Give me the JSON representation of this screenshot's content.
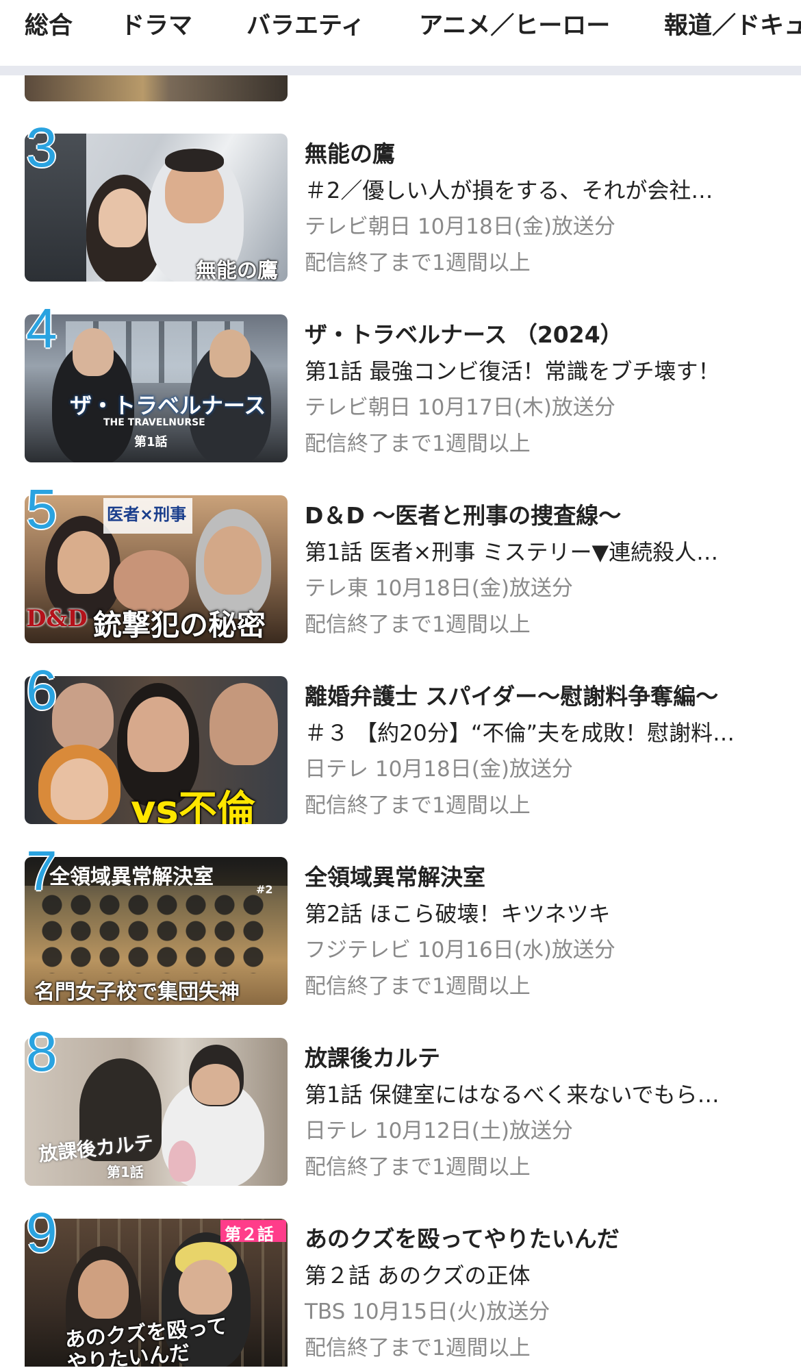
{
  "tabs": [
    {
      "label": "総合"
    },
    {
      "label": "ドラマ"
    },
    {
      "label": "バラエティ"
    },
    {
      "label": "アニメ／ヒーロー"
    },
    {
      "label": "報道／ドキュ"
    }
  ],
  "active_tab": "ドラマ",
  "accent_color": "#2aa3e0",
  "items": [
    {
      "rank": "3",
      "title": "無能の鷹",
      "episode": "＃2／優しい人が損をする、それが会社…",
      "meta": "テレビ朝日 10月18日(金)放送分",
      "remaining": "配信終了まで1週間以上",
      "thumb_text": "無能の鷹"
    },
    {
      "rank": "4",
      "title": "ザ・トラベルナース （2024）",
      "episode": "第1話 最強コンビ復活！常識をブチ壊す！",
      "meta": "テレビ朝日 10月17日(木)放送分",
      "remaining": "配信終了まで1週間以上",
      "thumb_text": "ザ・トラベルナース",
      "thumb_sub": "THE TRAVELNURSE",
      "thumb_ep": "第1話"
    },
    {
      "rank": "5",
      "title": "D＆D ～医者と刑事の捜査線～",
      "episode": "第1話 医者×刑事 ミステリー▼連続殺人…",
      "meta": "テレ東 10月18日(金)放送分",
      "remaining": "配信終了まで1週間以上",
      "thumb_text": "銃撃犯の秘密",
      "thumb_top": "医者×刑事",
      "thumb_logo": "D&D"
    },
    {
      "rank": "6",
      "title": "離婚弁護士 スパイダー～慰謝料争奪編～",
      "episode": "＃３ 【約20分】“不倫”夫を成敗！慰謝料…",
      "meta": "日テレ 10月18日(金)放送分",
      "remaining": "配信終了まで1週間以上",
      "thumb_text": "vs不倫"
    },
    {
      "rank": "7",
      "title": "全領域異常解決室",
      "episode": "第2話 ほこら破壊！キツネツキ",
      "meta": "フジテレビ 10月16日(水)放送分",
      "remaining": "配信終了まで1週間以上",
      "thumb_text": "名門女子校で集団失神",
      "thumb_top": "全領域異常解決室",
      "thumb_ep": "#2"
    },
    {
      "rank": "8",
      "title": "放課後カルテ",
      "episode": "第1話 保健室にはなるべく来ないでもら…",
      "meta": "日テレ 10月12日(土)放送分",
      "remaining": "配信終了まで1週間以上",
      "thumb_text": "放課後カルテ",
      "thumb_ep": "第1話"
    },
    {
      "rank": "9",
      "title": "あのクズを殴ってやりたいんだ",
      "episode": "第２話 あのクズの正体",
      "meta": "TBS 10月15日(火)放送分",
      "remaining": "配信終了まで1週間以上",
      "thumb_text": "あのクズを殴って やりたいんだ",
      "thumb_ep": "第２話"
    }
  ]
}
